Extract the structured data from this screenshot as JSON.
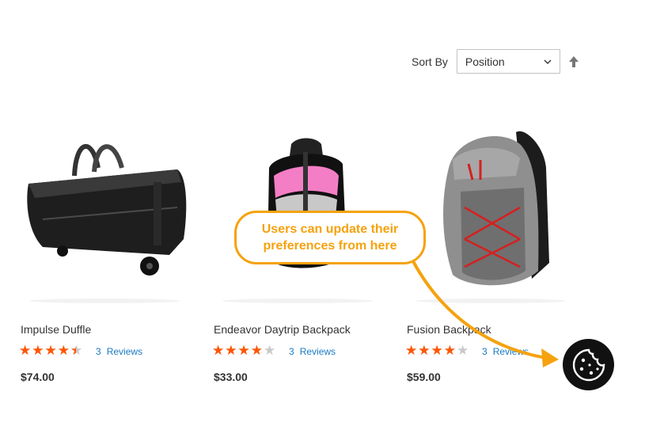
{
  "toolbar": {
    "sort_label": "Sort By",
    "sort_value": "Position"
  },
  "products": [
    {
      "name": "Impulse Duffle",
      "rating_fraction": 0.8,
      "review_count": "3",
      "review_label": "Reviews",
      "price": "$74.00"
    },
    {
      "name": "Endeavor Daytrip Backpack",
      "rating_fraction": 0.7,
      "review_count": "3",
      "review_label": "Reviews",
      "price": "$33.00"
    },
    {
      "name": "Fusion Backpack",
      "rating_fraction": 0.7,
      "review_count": "3",
      "review_label": "Reviews",
      "price": "$59.00"
    }
  ],
  "callout": {
    "text": "Users can update their\npreferences from here"
  },
  "colors": {
    "star_active": "#ff5501",
    "link": "#1979c3",
    "callout": "#f5a20e",
    "cookie_button": "#111111"
  },
  "icons": {
    "sort_direction": "arrow-up-icon",
    "select_caret": "chevron-down-icon",
    "cookie": "cookie-icon"
  }
}
